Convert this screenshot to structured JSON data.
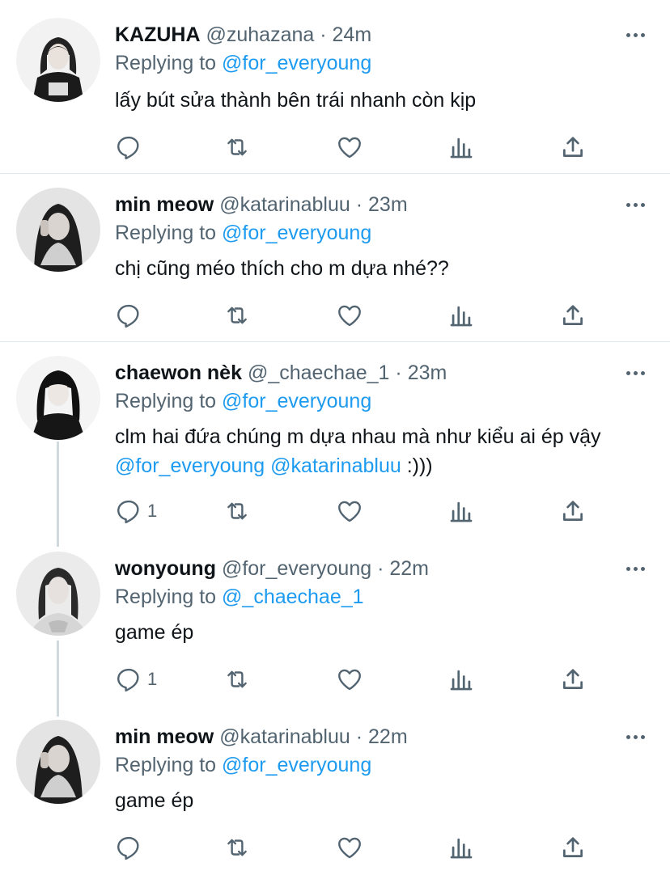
{
  "tweets": [
    {
      "name": "KAZUHA",
      "handle": "@zuhazana",
      "dot": " · ",
      "time": "24m",
      "replying_label": "Replying to ",
      "replying_to": "@for_everyoung",
      "text_parts": [
        "lấy bút sửa thành bên trái nhanh còn kịp"
      ],
      "reply_count": "",
      "avatar_icon": "person-photo"
    },
    {
      "name": "min meow",
      "handle": "@katarinabluu",
      "dot": " · ",
      "time": "23m",
      "replying_label": "Replying to ",
      "replying_to": "@for_everyoung",
      "text_parts": [
        "chị cũng méo thích cho m dựa nhé??"
      ],
      "reply_count": "",
      "avatar_icon": "person-photo"
    },
    {
      "name": "chaewon nèk",
      "handle": "@_chaechae_1",
      "dot": " · ",
      "time": "23m",
      "replying_label": "Replying to ",
      "replying_to": "@for_everyoung",
      "text_parts": [
        "clm hai đứa chúng m dựa nhau mà như kiểu ai ép vậy ",
        "@for_everyoung",
        " ",
        "@katarinabluu",
        " :)))"
      ],
      "reply_count": "1",
      "avatar_icon": "person-photo"
    },
    {
      "name": "wonyoung",
      "handle": "@for_everyoung",
      "dot": " · ",
      "time": "22m",
      "replying_label": "Replying to ",
      "replying_to": "@_chaechae_1",
      "text_parts": [
        "game ép"
      ],
      "reply_count": "1",
      "avatar_icon": "person-photo"
    },
    {
      "name": "min meow",
      "handle": "@katarinabluu",
      "dot": " · ",
      "time": "22m",
      "replying_label": "Replying to ",
      "replying_to": "@for_everyoung",
      "text_parts": [
        "game ép"
      ],
      "reply_count": "",
      "avatar_icon": "person-photo"
    }
  ],
  "icons": {
    "reply": "reply-icon",
    "retweet": "retweet-icon",
    "like": "heart-icon",
    "analytics": "analytics-icon",
    "share": "share-icon",
    "more": "more-icon"
  },
  "colors": {
    "link": "#1d9bf0",
    "secondary": "#536471",
    "divider": "#e1e8ed"
  }
}
